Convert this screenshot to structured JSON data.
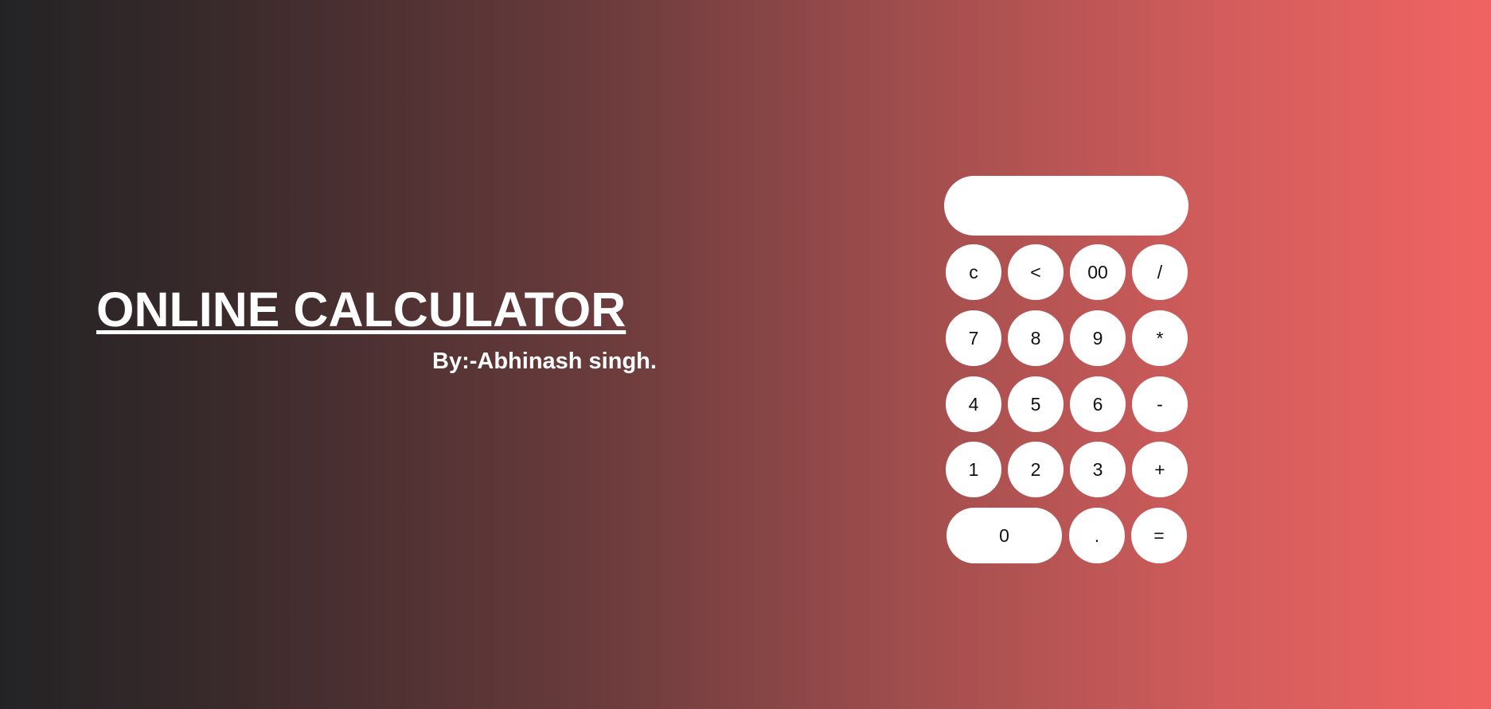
{
  "header": {
    "title": "ONLINE CALCULATOR",
    "byline": "By:-Abhinash singh."
  },
  "calculator": {
    "display_value": "",
    "keys": {
      "clear": "c",
      "backspace": "<",
      "double_zero": "00",
      "divide": "/",
      "seven": "7",
      "eight": "8",
      "nine": "9",
      "multiply": "*",
      "four": "4",
      "five": "5",
      "six": "6",
      "subtract": "-",
      "one": "1",
      "two": "2",
      "three": "3",
      "add": "+",
      "zero": "0",
      "decimal": ".",
      "equals": "="
    }
  },
  "colors": {
    "gradient_start": "#232325",
    "gradient_end": "#f16363",
    "key_background": "#ffffff",
    "text_light": "#ffffff",
    "text_dark": "#111111"
  }
}
